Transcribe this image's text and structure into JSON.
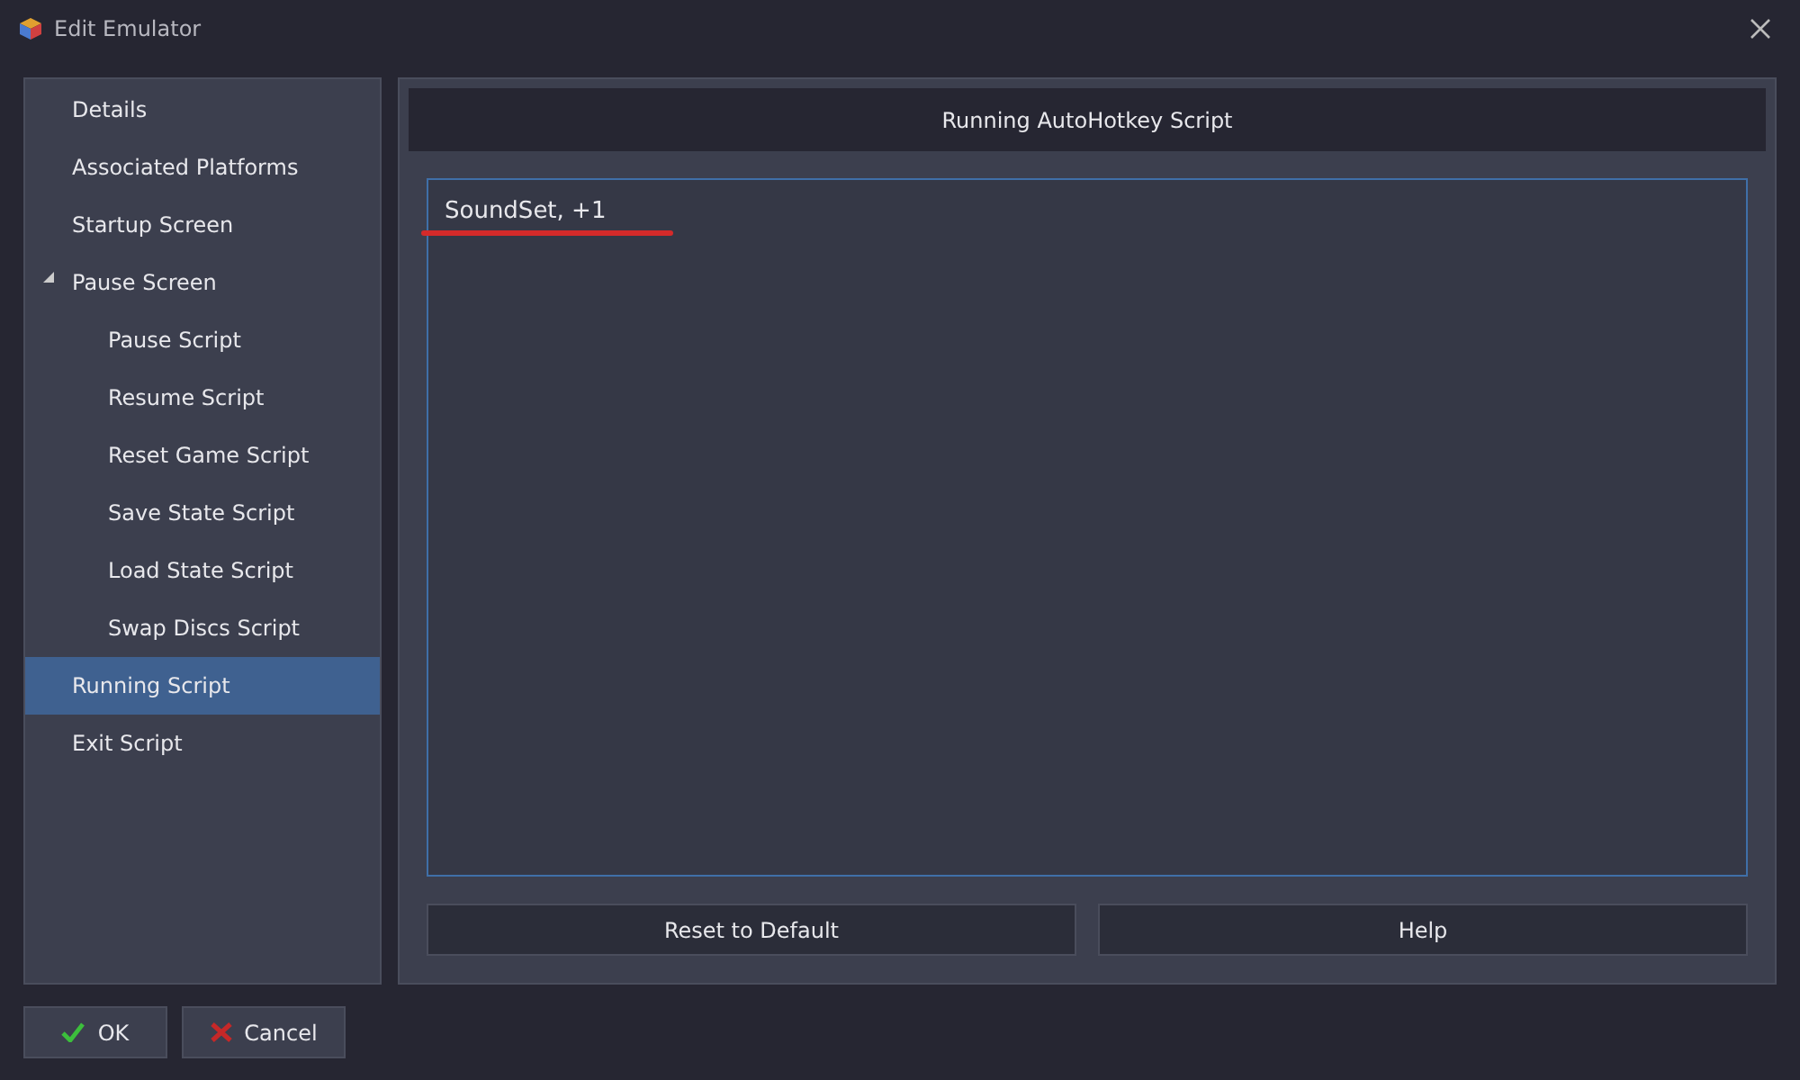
{
  "window": {
    "title": "Edit Emulator"
  },
  "sidebar": {
    "items": [
      {
        "label": "Details",
        "selected": false
      },
      {
        "label": "Associated Platforms",
        "selected": false
      },
      {
        "label": "Startup Screen",
        "selected": false
      },
      {
        "label": "Pause Screen",
        "selected": false,
        "expanded": true,
        "children": [
          {
            "label": "Pause Script",
            "selected": false
          },
          {
            "label": "Resume Script",
            "selected": false
          },
          {
            "label": "Reset Game Script",
            "selected": false
          },
          {
            "label": "Save State Script",
            "selected": false
          },
          {
            "label": "Load State Script",
            "selected": false
          },
          {
            "label": "Swap Discs Script",
            "selected": false
          }
        ]
      },
      {
        "label": "Running Script",
        "selected": true
      },
      {
        "label": "Exit Script",
        "selected": false
      }
    ]
  },
  "panel": {
    "header": "Running AutoHotkey Script",
    "editor": {
      "value": "SoundSet, +1"
    },
    "buttons": [
      "Reset to Default",
      "Help"
    ]
  },
  "footer": {
    "buttons": [
      {
        "kind": "ok",
        "label": "OK"
      },
      {
        "kind": "cancel",
        "label": "Cancel"
      }
    ]
  }
}
